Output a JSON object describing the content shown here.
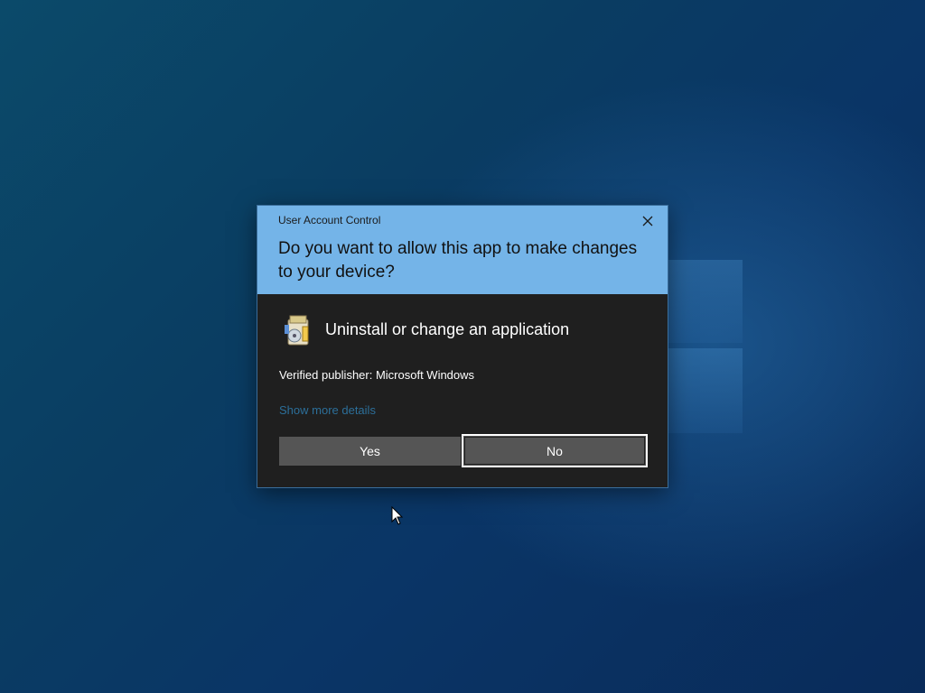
{
  "desktop": {
    "logo_icon": "windows-logo-icon"
  },
  "dialog": {
    "window_title": "User Account Control",
    "close_icon": "close-icon",
    "question": "Do you want to allow this app to make changes to your device?",
    "app": {
      "icon": "installer-icon",
      "name": "Uninstall or change an application"
    },
    "publisher": {
      "label": "Verified publisher: Microsoft Windows"
    },
    "details_link": "Show more details",
    "buttons": {
      "yes": "Yes",
      "no": "No"
    },
    "colors": {
      "header": "#74b4e8",
      "body": "#1f1f1f",
      "button": "#555555",
      "link": "#2c6f9a"
    }
  },
  "cursor_icon": "mouse-pointer-icon"
}
